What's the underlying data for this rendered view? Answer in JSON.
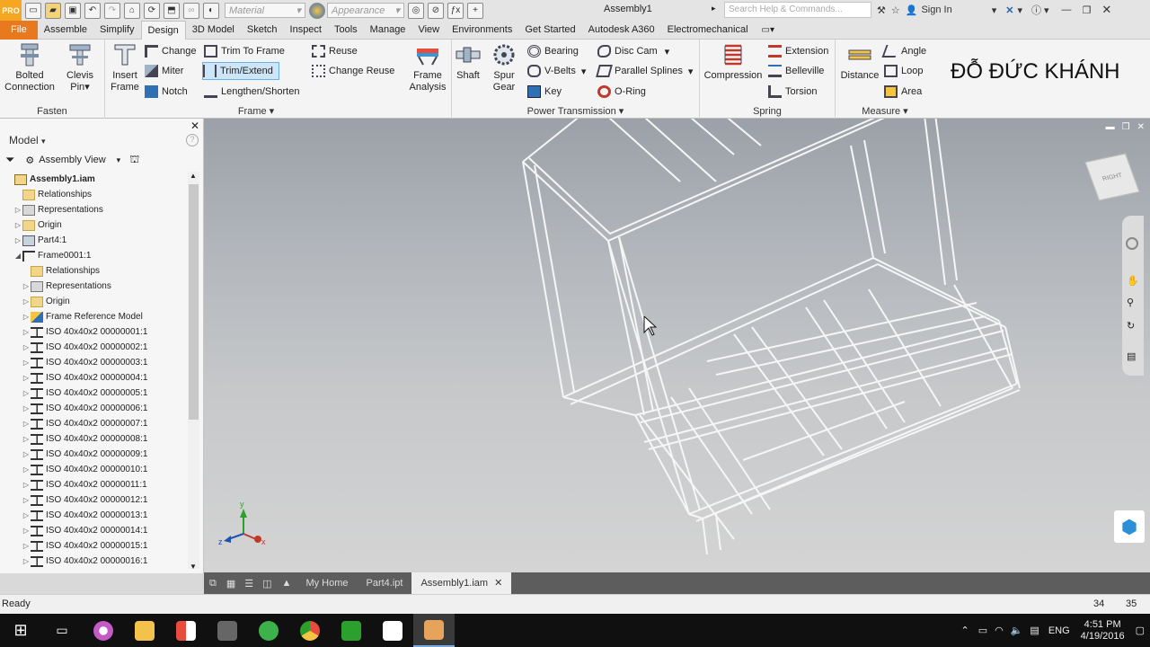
{
  "qat": {
    "logo": "PRO",
    "material_placeholder": "Material",
    "appearance_placeholder": "Appearance",
    "title": "Assembly1",
    "search_placeholder": "Search Help & Commands...",
    "sign_in": "Sign In"
  },
  "menu": [
    "File",
    "Assemble",
    "Simplify",
    "Design",
    "3D Model",
    "Sketch",
    "Inspect",
    "Tools",
    "Manage",
    "View",
    "Environments",
    "Get Started",
    "Autodesk A360",
    "Electromechanical"
  ],
  "menu_active": "Design",
  "ribbon": {
    "fasten": {
      "title": "Fasten",
      "bolted": "Bolted\nConnection",
      "clevis": "Clevis\nPin"
    },
    "frame": {
      "title": "Frame",
      "insert": "Insert\nFrame",
      "change": "Change",
      "miter": "Miter",
      "notch": "Notch",
      "trim_to_frame": "Trim To Frame",
      "trim_extend": "Trim/Extend",
      "lengthen": "Lengthen/Shorten",
      "reuse": "Reuse",
      "change_reuse": "Change Reuse",
      "analysis": "Frame\nAnalysis"
    },
    "power": {
      "title": "Power Transmission",
      "shaft": "Shaft",
      "spur": "Spur\nGear",
      "bearing": "Bearing",
      "vbelts": "V-Belts",
      "key": "Key",
      "disc_cam": "Disc Cam",
      "parallel_splines": "Parallel Splines",
      "oring": "O-Ring"
    },
    "spring": {
      "title": "Spring",
      "compression": "Compression",
      "extension": "Extension",
      "belleville": "Belleville",
      "torsion": "Torsion"
    },
    "measure": {
      "title": "Measure",
      "distance": "Distance",
      "angle": "Angle",
      "loop": "Loop",
      "area": "Area"
    }
  },
  "watermark": "ĐỖ ĐỨC KHÁNH",
  "model_panel": {
    "title": "Model",
    "view": "Assembly View",
    "tree": [
      {
        "label": "Assembly1.iam",
        "level": 0,
        "icon": "asm",
        "bold": true,
        "arrow": ""
      },
      {
        "label": "Relationships",
        "level": 1,
        "icon": "folder",
        "arrow": ""
      },
      {
        "label": "Representations",
        "level": 1,
        "icon": "rep",
        "arrow": "▷"
      },
      {
        "label": "Origin",
        "level": 1,
        "icon": "folder",
        "arrow": "▷"
      },
      {
        "label": "Part4:1",
        "level": 1,
        "icon": "part",
        "arrow": "▷"
      },
      {
        "label": "Frame0001:1",
        "level": 1,
        "icon": "frame",
        "arrow": "◢"
      },
      {
        "label": "Relationships",
        "level": 2,
        "icon": "folder",
        "arrow": ""
      },
      {
        "label": "Representations",
        "level": 2,
        "icon": "rep",
        "arrow": "▷"
      },
      {
        "label": "Origin",
        "level": 2,
        "icon": "folder",
        "arrow": "▷"
      },
      {
        "label": "Frame Reference Model",
        "level": 2,
        "icon": "ref",
        "arrow": "▷"
      },
      {
        "label": "ISO 40x40x2 00000001:1",
        "level": 2,
        "icon": "ibeam",
        "arrow": "▷"
      },
      {
        "label": "ISO 40x40x2 00000002:1",
        "level": 2,
        "icon": "ibeam",
        "arrow": "▷"
      },
      {
        "label": "ISO 40x40x2 00000003:1",
        "level": 2,
        "icon": "ibeam",
        "arrow": "▷"
      },
      {
        "label": "ISO 40x40x2 00000004:1",
        "level": 2,
        "icon": "ibeam",
        "arrow": "▷"
      },
      {
        "label": "ISO 40x40x2 00000005:1",
        "level": 2,
        "icon": "ibeam",
        "arrow": "▷"
      },
      {
        "label": "ISO 40x40x2 00000006:1",
        "level": 2,
        "icon": "ibeam",
        "arrow": "▷"
      },
      {
        "label": "ISO 40x40x2 00000007:1",
        "level": 2,
        "icon": "ibeam",
        "arrow": "▷"
      },
      {
        "label": "ISO 40x40x2 00000008:1",
        "level": 2,
        "icon": "ibeam",
        "arrow": "▷"
      },
      {
        "label": "ISO 40x40x2 00000009:1",
        "level": 2,
        "icon": "ibeam",
        "arrow": "▷"
      },
      {
        "label": "ISO 40x40x2 00000010:1",
        "level": 2,
        "icon": "ibeam",
        "arrow": "▷"
      },
      {
        "label": "ISO 40x40x2 00000011:1",
        "level": 2,
        "icon": "ibeam",
        "arrow": "▷"
      },
      {
        "label": "ISO 40x40x2 00000012:1",
        "level": 2,
        "icon": "ibeam",
        "arrow": "▷"
      },
      {
        "label": "ISO 40x40x2 00000013:1",
        "level": 2,
        "icon": "ibeam",
        "arrow": "▷"
      },
      {
        "label": "ISO 40x40x2 00000014:1",
        "level": 2,
        "icon": "ibeam",
        "arrow": "▷"
      },
      {
        "label": "ISO 40x40x2 00000015:1",
        "level": 2,
        "icon": "ibeam",
        "arrow": "▷"
      },
      {
        "label": "ISO 40x40x2 00000016:1",
        "level": 2,
        "icon": "ibeam",
        "arrow": "▷"
      }
    ]
  },
  "viewcube_label": "RIGHT",
  "doc_tabs": [
    "My Home",
    "Part4.ipt",
    "Assembly1.iam"
  ],
  "doc_tab_active": "Assembly1.iam",
  "status": {
    "text": "Ready",
    "n1": "34",
    "n2": "35"
  },
  "tray": {
    "lang": "ENG",
    "time": "4:51 PM",
    "date": "4/19/2016"
  },
  "colors": {
    "accent": "#e8791e",
    "highlight": "#cde6f7",
    "taskbar": "#101010"
  }
}
